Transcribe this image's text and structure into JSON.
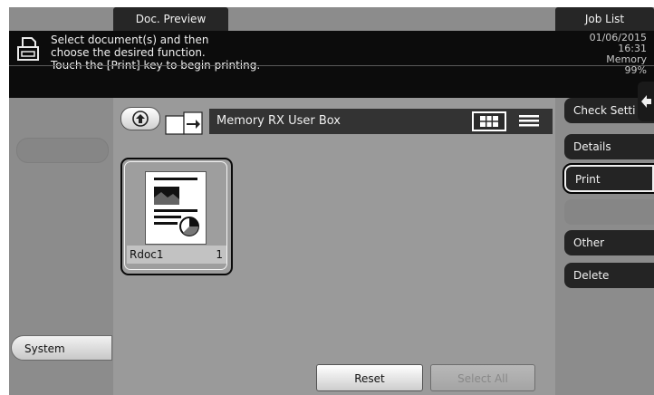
{
  "tabs": {
    "preview": "Doc. Preview",
    "job_list": "Job List"
  },
  "message": {
    "line1": "Select document(s) and then",
    "line2": "choose the desired function.",
    "line3": "Touch the [Print] key to begin printing."
  },
  "status": {
    "date": "01/06/2015",
    "time": "16:31",
    "memory_label": "Memory",
    "memory_value": "99%"
  },
  "left_nav": {
    "system_label": "System"
  },
  "box": {
    "name": "Memory RX User Box"
  },
  "documents": [
    {
      "name": "Rdoc1",
      "pages": "1"
    }
  ],
  "buttons": {
    "reset": "Reset",
    "select_all": "Select All"
  },
  "right_menu": {
    "check_settings": "Check Setti",
    "details": "Details",
    "print": "Print",
    "other": "Other",
    "delete": "Delete"
  },
  "colors": {
    "panel_bg": "#8c8c8c",
    "message_bar": "#0c0c0c",
    "dark_button": "#242424"
  }
}
